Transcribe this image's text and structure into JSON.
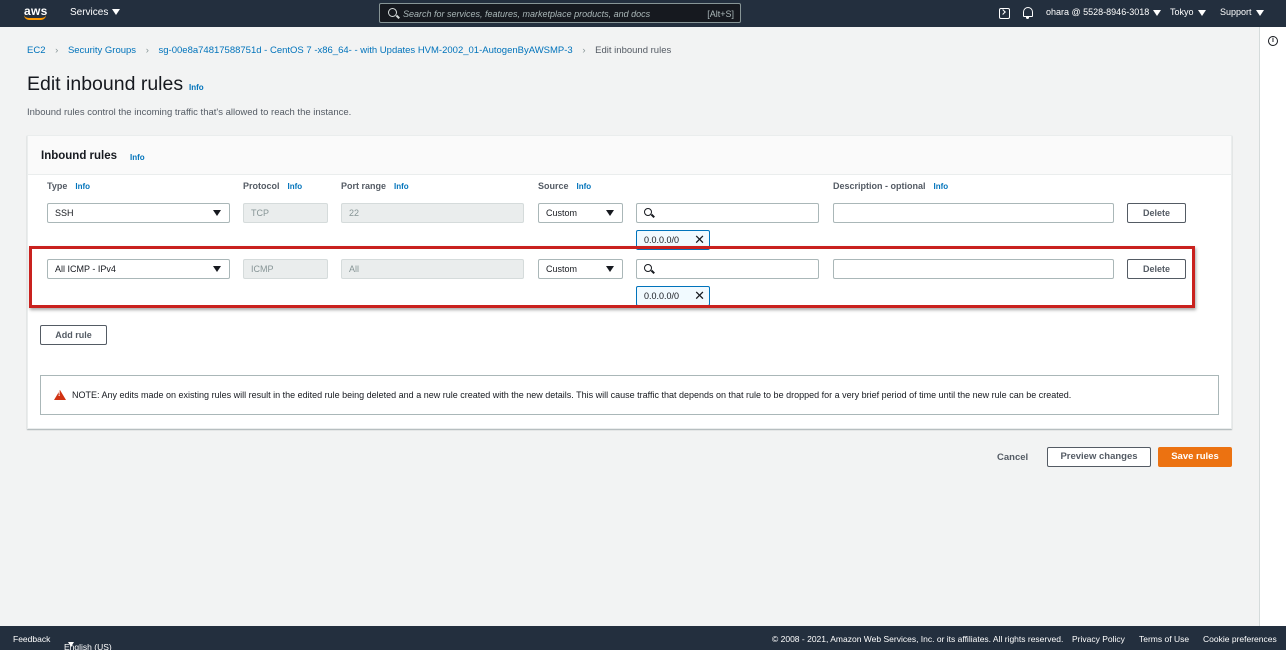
{
  "topnav": {
    "logo": "aws",
    "services_label": "Services",
    "search_placeholder": "Search for services, features, marketplace products, and docs",
    "search_shortcut": "[Alt+S]",
    "account": "ohara @ 5528-8946-3018",
    "region": "Tokyo",
    "support": "Support",
    "icons": [
      "terminal-icon",
      "bell-icon"
    ]
  },
  "breadcrumb": {
    "items": [
      "EC2",
      "Security Groups",
      "sg-00e8a74817588751d - CentOS 7 -x86_64- - with Updates HVM-2002_01-AutogenByAWSMP-3"
    ],
    "current": "Edit inbound rules"
  },
  "page": {
    "title": "Edit inbound rules",
    "info": "Info",
    "description": "Inbound rules control the incoming traffic that's allowed to reach the instance."
  },
  "panel": {
    "title": "Inbound rules",
    "info": "Info",
    "columns": {
      "type": "Type",
      "protocol": "Protocol",
      "port_range": "Port range",
      "source": "Source",
      "description": "Description - optional",
      "info": "Info"
    },
    "rules": [
      {
        "type": "SSH",
        "protocol": "TCP",
        "port_range": "22",
        "source_mode": "Custom",
        "search_value": "",
        "cidr": "0.0.0.0/0",
        "description": "",
        "delete_label": "Delete"
      },
      {
        "type": "All ICMP - IPv4",
        "protocol": "ICMP",
        "port_range": "All",
        "source_mode": "Custom",
        "search_value": "",
        "cidr": "0.0.0.0/0",
        "description": "",
        "delete_label": "Delete"
      }
    ],
    "add_rule_label": "Add rule",
    "note": "NOTE: Any edits made on existing rules will result in the edited rule being deleted and a new rule created with the new details. This will cause traffic that depends on that rule to be dropped for a very brief period of time until the new rule can be created."
  },
  "actions": {
    "cancel": "Cancel",
    "preview": "Preview changes",
    "save": "Save rules"
  },
  "footer": {
    "feedback": "Feedback",
    "language": "English (US)",
    "copyright": "© 2008 - 2021, Amazon Web Services, Inc. or its affiliates. All rights reserved.",
    "privacy": "Privacy Policy",
    "terms": "Terms of Use",
    "cookies": "Cookie preferences"
  },
  "colors": {
    "nav_bg": "#232f3e",
    "link": "#0073bb",
    "primary": "#ec7211",
    "highlight": "#c9211e"
  }
}
